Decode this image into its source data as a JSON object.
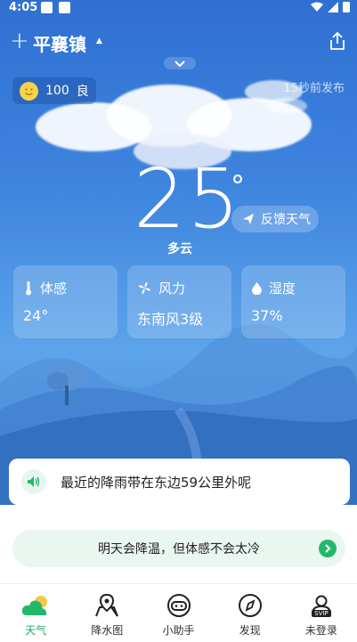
{
  "status_bar": {
    "time": "4:05"
  },
  "header": {
    "city": "平襄镇"
  },
  "aqi": {
    "value": "100",
    "level": "良"
  },
  "published": "15秒前发布",
  "weather": {
    "temperature": "25",
    "degree_symbol": "°",
    "condition": "多云"
  },
  "feedback_label": "反馈天气",
  "cards": [
    {
      "title": "体感",
      "value": "24°",
      "icon": "thermometer-icon"
    },
    {
      "title": "风力",
      "value": "东南风3级",
      "icon": "fan-icon"
    },
    {
      "title": "湿度",
      "value": "37%",
      "icon": "droplet-icon"
    }
  ],
  "rain_alert": "最近的降雨带在东边59公里外呢",
  "tip": "明天会降温，但体感不会太冷",
  "tabs": [
    {
      "label": "天气",
      "icon": "cloud-sun-icon"
    },
    {
      "label": "降水图",
      "icon": "map-pin-icon"
    },
    {
      "label": "小助手",
      "icon": "assistant-icon"
    },
    {
      "label": "发现",
      "icon": "compass-icon"
    },
    {
      "label": "未登录",
      "icon": "svip-user-icon",
      "badge": "SVIP"
    }
  ],
  "colors": {
    "accent": "#22b86a",
    "sky": "#3f86df"
  }
}
